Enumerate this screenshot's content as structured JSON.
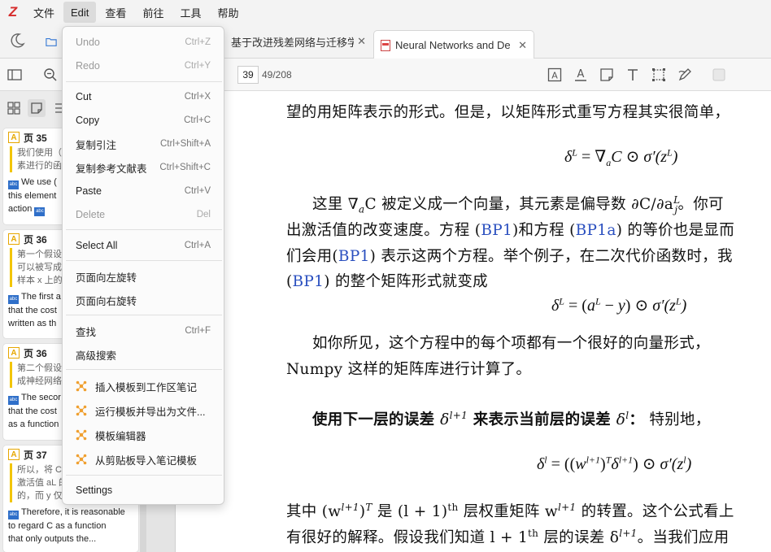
{
  "app": {
    "logo": "Z"
  },
  "menubar": {
    "items": [
      "文件",
      "Edit",
      "查看",
      "前往",
      "工具",
      "帮助"
    ]
  },
  "tabs": {
    "cn_tab": "基于改进残差网络与迁移学",
    "pdf_tab": "Neural Networks and De"
  },
  "toolbar": {
    "page_number": "39",
    "page_total": "49/208"
  },
  "sidebar": {
    "cards": [
      {
        "page": "页 35",
        "quote": [
          "我们使用（",
          "素进行的函"
        ],
        "comment": [
          "We use (",
          "this element",
          "action"
        ]
      },
      {
        "page": "页 36",
        "quote": [
          "第一个假设",
          "可以被写成",
          "样本 x 上的"
        ],
        "comment": [
          "The first a",
          "that the cost",
          "written as th"
        ]
      },
      {
        "page": "页 36",
        "quote": [
          "第二个假设",
          "成神经网络"
        ],
        "comment": [
          "The secor",
          "that the cost",
          "as a function"
        ]
      },
      {
        "page": "页 37",
        "quote": [
          "所以，将 C",
          "激活值 aL 的",
          "的，而 y 仅"
        ],
        "comment": [
          "Therefore, it is reasonable",
          "to regard C as a function",
          "that only outputs the..."
        ]
      }
    ]
  },
  "menu": {
    "undo": "Undo",
    "undo_sc": "Ctrl+Z",
    "redo": "Redo",
    "redo_sc": "Ctrl+Y",
    "cut": "Cut",
    "cut_sc": "Ctrl+X",
    "copy": "Copy",
    "copy_sc": "Ctrl+C",
    "copy_citation": "复制引注",
    "copy_citation_sc": "Ctrl+Shift+A",
    "copy_bib": "复制参考文献表",
    "copy_bib_sc": "Ctrl+Shift+C",
    "paste": "Paste",
    "paste_sc": "Ctrl+V",
    "delete": "Delete",
    "delete_sc": "Del",
    "select_all": "Select All",
    "select_all_sc": "Ctrl+A",
    "rotate_left": "页面向左旋转",
    "rotate_right": "页面向右旋转",
    "find": "查找",
    "find_sc": "Ctrl+F",
    "advanced_search": "高级搜索",
    "insert_template": "插入模板到工作区笔记",
    "run_template": "运行模板并导出为文件...",
    "template_editor": "模板编辑器",
    "import_template": "从剪贴板导入笔记模板",
    "settings": "Settings"
  },
  "doc": {
    "line1": "望的用矩阵表示的形式。但是，以矩阵形式重写方程其实很简单，",
    "eq1": "δ^L = ∇_a C ⊙ σ′(z^L)",
    "p2_l1_a": "这里 ∇",
    "p2_l1_b": "C 被定义成一个向量，其元素是偏导数 ∂C/∂a",
    "p2_l1_c": "。你可",
    "p2_l2_a": "出激活值的改变速度。方程 (",
    "bp1": "BP1",
    "p2_l2_b": ")和方程 (",
    "bp1a": "BP1a",
    "p2_l2_c": ") 的等价也是显而",
    "p2_l3_a": "们会用(",
    "p2_l3_b": ") 表示这两个方程。举个例子，在二次代价函数时，我",
    "p2_l4_a": "(",
    "p2_l4_b": ") 的整个矩阵形式就变成",
    "eq2": "δ^L = (a^L − y) ⊙ σ′(z^L)",
    "p3_l1": "如你所见，这个方程中的每个项都有一个很好的向量形式，",
    "p3_l2": "Numpy 这样的矩阵库进行计算了。",
    "p4_bold_a": "使用下一层的误差 ",
    "p4_bold_b": " 来表示当前层的误差 ",
    "p4_colon": "：",
    "p4_tail": "特别地，",
    "eq3": "δ^l = ((w^{l+1})^T δ^{l+1}) ⊙ σ′(z^l)",
    "p5_l1_a": "其中 (w",
    "p5_l1_b": ")",
    "p5_l1_c": " 是 (l + 1)",
    "p5_l1_d": " 层权重矩阵 w",
    "p5_l1_e": " 的转置。这个公式看上",
    "p5_l2_a": "有很好的解释。假设我们知道 l + 1",
    "p5_l2_b": " 层的误差 δ",
    "p5_l2_c": "。当我们应用",
    "sup_th": "th",
    "sup_l1": "l+1",
    "sup_T": "T",
    "sup_L": "L",
    "sub_a": "a",
    "sub_j": "j",
    "sup_l": "l"
  }
}
